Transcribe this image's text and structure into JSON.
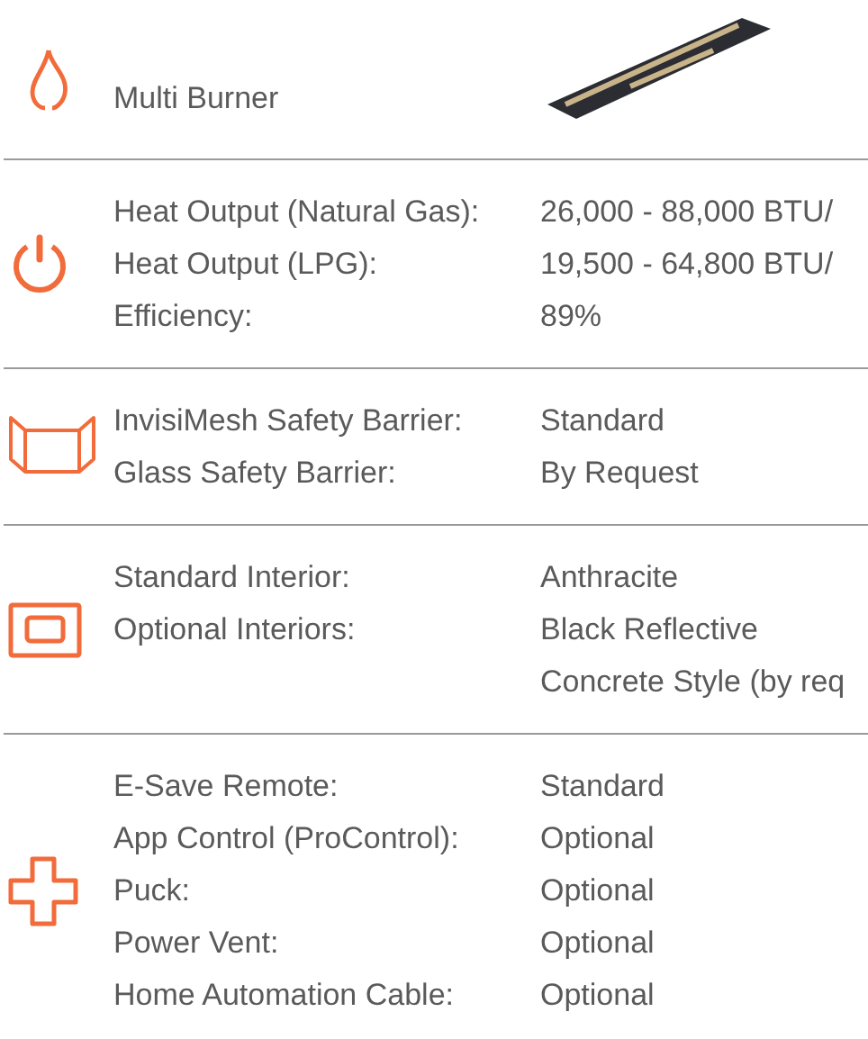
{
  "sections": [
    {
      "kind": "feature",
      "title": "Multi Burner"
    },
    {
      "kind": "specs",
      "rows": [
        {
          "label": "Heat Output (Natural Gas):",
          "values": [
            "26,000 - 88,000 BTU/"
          ]
        },
        {
          "label": "Heat Output (LPG):",
          "values": [
            "19,500 - 64,800 BTU/"
          ]
        },
        {
          "label": "Efficiency:",
          "values": [
            "89%"
          ]
        }
      ]
    },
    {
      "kind": "specs",
      "rows": [
        {
          "label": "InvisiMesh Safety Barrier:",
          "values": [
            "Standard"
          ]
        },
        {
          "label": "Glass Safety Barrier:",
          "values": [
            "By Request"
          ]
        }
      ]
    },
    {
      "kind": "specs",
      "rows": [
        {
          "label": "Standard Interior:",
          "values": [
            "Anthracite"
          ]
        },
        {
          "label": "Optional Interiors:",
          "values": [
            "Black Reflective",
            "Concrete Style (by req"
          ]
        }
      ]
    },
    {
      "kind": "specs",
      "rows": [
        {
          "label": "E-Save Remote:",
          "values": [
            "Standard"
          ]
        },
        {
          "label": "App Control (ProControl):",
          "values": [
            "Optional"
          ]
        },
        {
          "label": "Puck:",
          "values": [
            "Optional"
          ]
        },
        {
          "label": "Power Vent:",
          "values": [
            "Optional"
          ]
        },
        {
          "label": "Home Automation Cable:",
          "values": [
            "Optional"
          ]
        }
      ]
    }
  ]
}
